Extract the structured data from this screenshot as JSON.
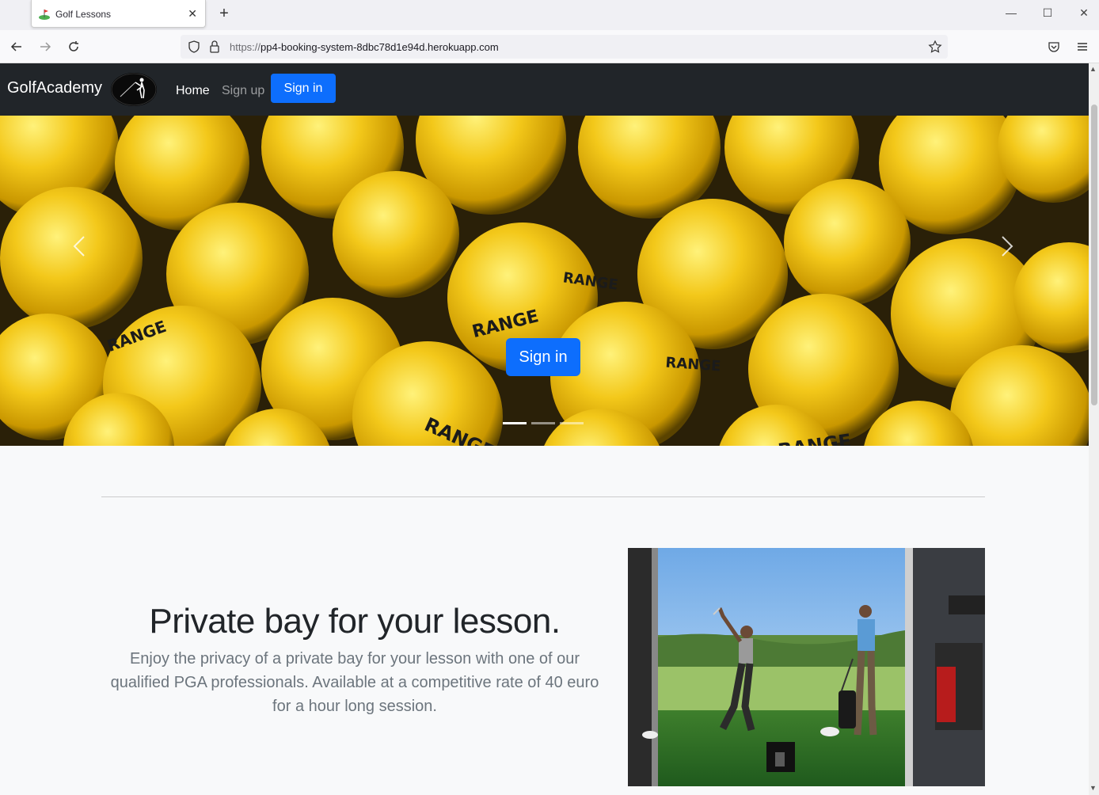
{
  "browser": {
    "tab_title": "Golf Lessons",
    "url_protocol": "https://",
    "url_host": "pp4-booking-system-8dbc78d1e94d.herokuapp.com"
  },
  "site": {
    "brand": "GolfAcademy",
    "nav": {
      "home": "Home",
      "signup": "Sign up",
      "signin": "Sign in"
    }
  },
  "carousel": {
    "button_label": "Sign in",
    "slide_count": 3,
    "active_slide": 1,
    "ball_text": "RANGE"
  },
  "feature": {
    "heading": "Private bay for your lesson.",
    "lead": "Enjoy the privacy of a private bay for your lesson with one of our qualified PGA professionals. Available at a competitive rate of 40 euro for a hour long session."
  },
  "colors": {
    "navbar_bg": "#212529",
    "primary": "#0d6efd",
    "page_bg": "#f8f9fa"
  }
}
